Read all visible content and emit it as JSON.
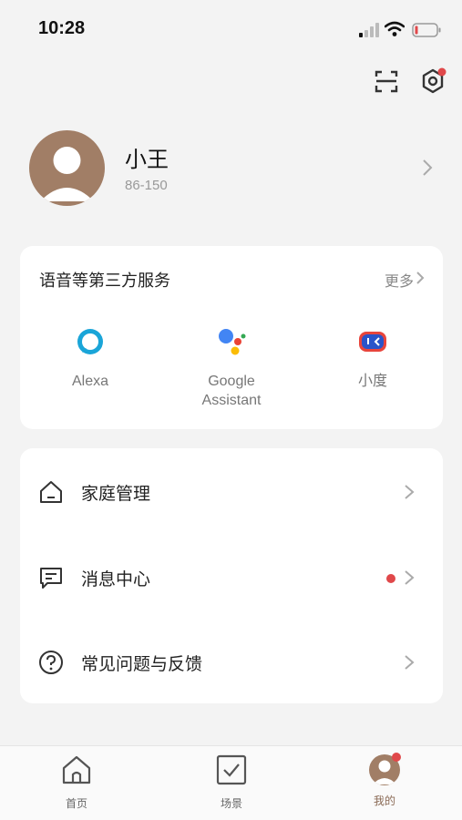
{
  "status_bar": {
    "time": "10:28"
  },
  "profile": {
    "name": "小王",
    "user_id": "86-150"
  },
  "services": {
    "title": "语音等第三方服务",
    "more_label": "更多",
    "items": [
      {
        "label": "Alexa",
        "icon": "alexa-icon"
      },
      {
        "label": "Google\nAssistant",
        "icon": "google-assistant-icon"
      },
      {
        "label": "小度",
        "icon": "xiaodu-icon"
      }
    ]
  },
  "menu": {
    "items": [
      {
        "label": "家庭管理",
        "icon": "home-icon"
      },
      {
        "label": "消息中心",
        "icon": "message-icon",
        "has_unread": true
      },
      {
        "label": "常见问题与反馈",
        "icon": "help-icon"
      }
    ]
  },
  "tabbar": {
    "items": [
      {
        "label": "首页",
        "icon": "home-tab-icon"
      },
      {
        "label": "场景",
        "icon": "scene-check-icon"
      },
      {
        "label": "我的",
        "icon": "avatar-icon",
        "active": true
      }
    ]
  },
  "colors": {
    "accent": "#8a6a55",
    "avatar_bg": "#a17e66",
    "badge_red": "#e0484a"
  }
}
